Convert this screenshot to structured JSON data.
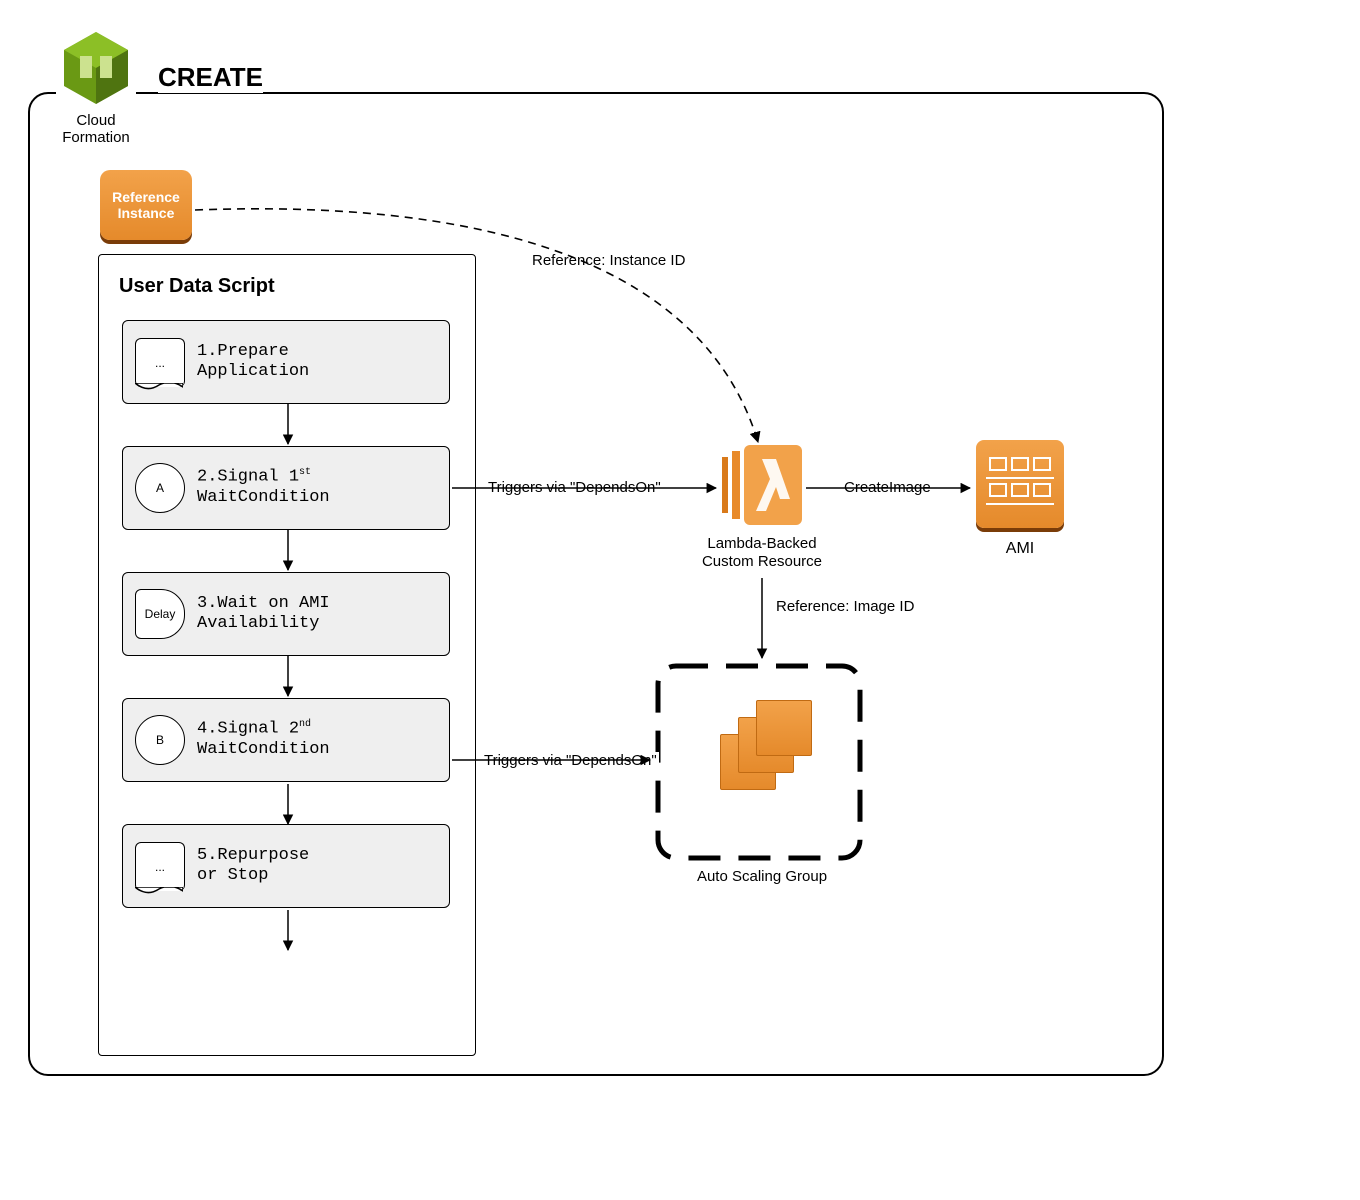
{
  "title": "CREATE",
  "cloudFormation": {
    "label": "Cloud\nFormation"
  },
  "referenceInstance": {
    "label": "Reference\nInstance"
  },
  "userDataScript": {
    "title": "User Data Script",
    "steps": [
      {
        "icon": "ellipsis",
        "iconText": "...",
        "num": "1.",
        "line1": "Prepare",
        "line2": "Application"
      },
      {
        "icon": "circle",
        "iconText": "A",
        "num": "2.",
        "line1": "Signal 1",
        "sup": "st",
        "line2": "WaitCondition"
      },
      {
        "icon": "delay",
        "iconText": "Delay",
        "num": "3.",
        "line1": "Wait on AMI",
        "line2": "Availability"
      },
      {
        "icon": "circle",
        "iconText": "B",
        "num": "4.",
        "line1": "Signal 2",
        "sup": "nd",
        "line2": "WaitCondition"
      },
      {
        "icon": "ellipsis",
        "iconText": "...",
        "num": "5.",
        "line1": "Repurpose",
        "line2": "or Stop"
      }
    ]
  },
  "edges": {
    "refToLambda": "Reference: Instance ID",
    "step2ToLambda": "Triggers via \"DependsOn\"",
    "lambdaToAmi": "CreateImage",
    "lambdaToAsg": "Reference: Image ID",
    "step4ToAsg": "Triggers via \"DependsOn\""
  },
  "lambda": {
    "label": "Lambda-Backed\nCustom Resource"
  },
  "ami": {
    "label": "AMI"
  },
  "asg": {
    "label": "Auto Scaling Group"
  }
}
